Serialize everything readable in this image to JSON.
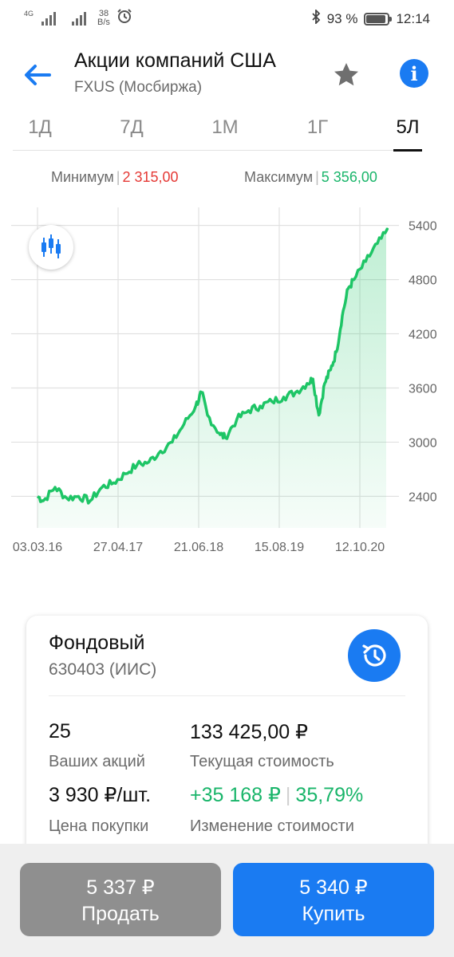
{
  "status_bar": {
    "network": "4G",
    "speed_value": "38",
    "speed_unit": "B/s",
    "battery_percent": "93 %",
    "battery_level": 0.93,
    "time": "12:14"
  },
  "header": {
    "title": "Акции компаний США",
    "subtitle": "FXUS (Мосбиржа)"
  },
  "periods": [
    {
      "label": "1Д",
      "active": false
    },
    {
      "label": "7Д",
      "active": false
    },
    {
      "label": "1М",
      "active": false
    },
    {
      "label": "1Г",
      "active": false
    },
    {
      "label": "5Л",
      "active": true
    }
  ],
  "range": {
    "min_label": "Минимум",
    "min_value": "2 315,00",
    "max_label": "Максимум",
    "max_value": "5 356,00"
  },
  "chart_data": {
    "type": "area",
    "x_ticks": [
      "03.03.16",
      "27.04.17",
      "21.06.18",
      "15.08.19",
      "12.10.20"
    ],
    "y_ticks": [
      "5400",
      "4800",
      "4200",
      "3600",
      "3000",
      "2400"
    ],
    "ylim": [
      2050,
      5600
    ],
    "grid": true,
    "line_color": "#1ec566",
    "fill_color": "#1ec566",
    "series": [
      {
        "x": [
          "2016-03",
          "2016-04",
          "2016-06",
          "2016-08",
          "2016-10",
          "2016-12",
          "2017-02",
          "2017-04",
          "2017-06",
          "2017-08",
          "2017-10",
          "2017-12",
          "2018-02",
          "2018-04",
          "2018-06",
          "2018-07",
          "2018-08",
          "2018-10",
          "2018-11",
          "2019-01",
          "2019-03",
          "2019-05",
          "2019-07",
          "2019-09",
          "2019-11",
          "2020-01",
          "2020-02",
          "2020-03",
          "2020-04",
          "2020-05",
          "2020-06",
          "2020-07",
          "2020-08",
          "2020-09",
          "2020-11",
          "2021-01",
          "2021-03"
        ],
        "values": [
          2400,
          2350,
          2500,
          2380,
          2400,
          2350,
          2500,
          2550,
          2650,
          2750,
          2780,
          2900,
          3000,
          3200,
          3400,
          3550,
          3300,
          3100,
          3050,
          3250,
          3350,
          3400,
          3450,
          3500,
          3550,
          3650,
          3700,
          3300,
          3650,
          3800,
          4000,
          4400,
          4700,
          4800,
          5000,
          5200,
          5356
        ]
      }
    ]
  },
  "card": {
    "title": "Фондовый",
    "subtitle": "630403 (ИИС)",
    "shares_count": "25",
    "shares_label": "Ваших акций",
    "current_value": "133 425,00 ₽",
    "current_value_label": "Текущая стоимость",
    "buy_price": "3 930 ₽/шт.",
    "buy_price_label": "Цена покупки",
    "change_amount": "+35 168 ₽",
    "change_percent": "35,79%",
    "change_label": "Изменение стоимости"
  },
  "actions": {
    "sell_price": "5 337 ₽",
    "sell_label": "Продать",
    "buy_price": "5 340 ₽",
    "buy_label": "Купить"
  },
  "colors": {
    "accent": "#1a7bf2",
    "positive": "#19b56a",
    "negative": "#e53935",
    "sell_button": "#8f8f8f"
  }
}
